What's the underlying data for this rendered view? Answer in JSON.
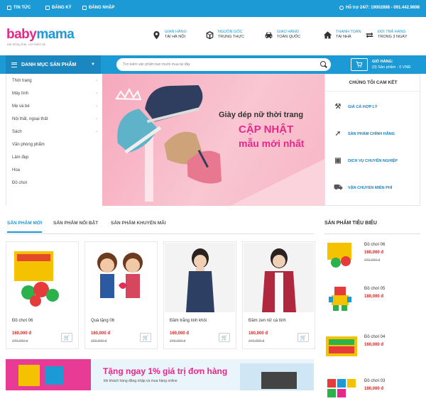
{
  "topbar": {
    "news": "TIN TỨC",
    "register": "ĐĂNG KÝ",
    "login": "ĐĂNG NHẬP",
    "hotline": "Hỗ trợ 24/7: 19002898 - 091.442.9898"
  },
  "logo": {
    "part1": "baby",
    "part2": "mama",
    "tagline": "Mẹ thông thái, con thiên tài"
  },
  "features": [
    {
      "line1": "GIAN HÀNG",
      "line2": "TẠI HÀ NỘI",
      "icon": "map-pin-icon"
    },
    {
      "line1": "NGUỒN GỐC",
      "line2": "TRUNG THỰC",
      "icon": "box-icon"
    },
    {
      "line1": "GIAO HÀNG",
      "line2": "TOÀN QUỐC",
      "icon": "car-icon"
    },
    {
      "line1": "THANH TOÁN",
      "line2": "TẠI NHÀ",
      "icon": "home-icon"
    },
    {
      "line1": "ĐỔI TRẢ HÀNG",
      "line2": "TRONG 3 NGÀY",
      "icon": "exchange-icon"
    }
  ],
  "nav": {
    "category_label": "DANH MỤC SẢN PHẨM",
    "search_placeholder": "Tìm kiếm sản phẩm bạn muốn mua tại đây",
    "cart_title": "GIỎ HÀNG:",
    "cart_summary": "(0) Sản phẩm - 0 VNĐ"
  },
  "categories": [
    {
      "label": "Thời trang",
      "arrow": "›"
    },
    {
      "label": "Máy tính",
      "arrow": "›"
    },
    {
      "label": "Mẹ và bé",
      "arrow": "›"
    },
    {
      "label": "Nội thất, ngoại thất",
      "arrow": "›"
    },
    {
      "label": "Sách",
      "arrow": "›"
    },
    {
      "label": "Văn phòng phẩm",
      "arrow": ""
    },
    {
      "label": "Làm đẹp",
      "arrow": ""
    },
    {
      "label": "Hoa",
      "arrow": ""
    },
    {
      "label": "Đồ chơi",
      "arrow": ""
    }
  ],
  "banner": {
    "line1": "Giày dép nữ thời trang",
    "line2": "CẬP NHẬT",
    "line3": "mẫu mới nhất"
  },
  "commitment": {
    "title": "CHÚNG TÔI CAM KẾT",
    "items": [
      {
        "label": "GIÁ CẢ HỢP LÝ",
        "icon": "gavel-icon"
      },
      {
        "label": "SẢN PHẨM CHÍNH HÃNG",
        "icon": "rocket-icon"
      },
      {
        "label": "DỊCH VỤ CHUYÊN NGHIỆP",
        "icon": "money-icon"
      },
      {
        "label": "VẬN CHUYỂN MIỄN PHÍ",
        "icon": "truck-icon"
      }
    ]
  },
  "tabs": [
    "SẢN PHẨM MỚI",
    "SẢN PHẨM NỔI BẬT",
    "SẢN PHẨM KHUYẾN MÃI"
  ],
  "products": [
    {
      "name": "Đồ chơi 06",
      "price": "160,000 đ",
      "old": "240,000 đ"
    },
    {
      "name": "Quà tặng 06",
      "price": "160,000 đ",
      "old": "220,000 đ"
    },
    {
      "name": "Đầm trắng tinh khôi",
      "price": "160,000 đ",
      "old": "240,000 đ"
    },
    {
      "name": "Đầm zen nữ cá tính",
      "price": "160,000 đ",
      "old": "240,000 đ"
    }
  ],
  "promo": {
    "title": "Tặng ngay 1% giá trị đơn hàng",
    "subtitle": "khi khách hàng đăng nhập và mua hàng online"
  },
  "featured": {
    "title": "SẢN PHẨM TIÊU BIỂU",
    "items": [
      {
        "name": "Đồ chơi 06",
        "price": "160,000 đ",
        "old": "240,000 đ"
      },
      {
        "name": "Đồ chơi 05",
        "price": "180,000 đ",
        "old": ""
      },
      {
        "name": "Đồ chơi 04",
        "price": "160,000 đ",
        "old": ""
      },
      {
        "name": "Đồ chơi 03",
        "price": "180,000 đ",
        "old": ""
      }
    ]
  },
  "colors": {
    "primary": "#1b9ad6",
    "accent": "#e8278a",
    "price": "#e02020"
  }
}
